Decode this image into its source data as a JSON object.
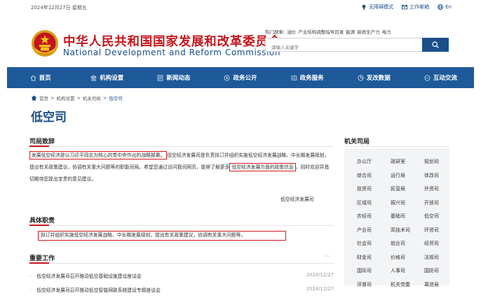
{
  "topbar": {
    "date": "2024年12月27日 星期五",
    "links": [
      {
        "icon": "accessibility-icon",
        "label": "无障碍模式"
      },
      {
        "icon": "mail-icon",
        "label": "工作邮箱"
      },
      {
        "icon": "globe-icon",
        "label": "En"
      }
    ]
  },
  "header": {
    "title_cn": "中华人民共和国国家发展和改革委员会",
    "title_en": "National Development and Reform Commission",
    "hot_label": "热门搜索:",
    "hot_keywords": [
      "油价",
      "产业结构调整指导目录",
      "能源",
      "新质生产力",
      "电力"
    ],
    "search_placeholder": "请输入关键字"
  },
  "nav": {
    "items": [
      {
        "label": "首页",
        "icon": "home-icon"
      },
      {
        "label": "机构设置",
        "icon": "building-icon"
      },
      {
        "label": "新闻动态",
        "icon": "news-icon"
      },
      {
        "label": "政务公开",
        "icon": "open-icon"
      },
      {
        "label": "政务服务",
        "icon": "service-icon"
      },
      {
        "label": "发改数据",
        "icon": "data-icon"
      },
      {
        "label": "互动交流",
        "icon": "chat-icon"
      }
    ]
  },
  "breadcrumb": {
    "items": [
      "首页",
      "机构设置",
      "机关司局",
      "低空司"
    ],
    "sep": ">"
  },
  "page": {
    "title": "低空司"
  },
  "intro": {
    "heading": "司局致辞",
    "hl1": "发展低空经济是以习近平同志为核心的党中央作出的战略部署。",
    "text1": "低空经济发展司是负责拟订并组织实施低空经济发展战略、中长期发展规划，提出有关政策建议，协调有关重大问题等的职能司局。希望您通过访问我司网页，能够了解更多",
    "hl2": "低空经济发展方面的政策信息",
    "text2": "，同时欢迎并恳切期待您提出宝贵的意见建议。",
    "sign": "低空经济发展司"
  },
  "duties": {
    "heading": "具体职责",
    "text": "拟订并组织实施低空经济发展战略、中长期发展规划，提出有关政策建议，协调有关重大问题等。"
  },
  "work": {
    "heading": "重要工作",
    "more": "···",
    "items": [
      {
        "title": "低空经济发展司召开推动低空基础设施建设座谈会",
        "date": "2024/12/27"
      },
      {
        "title": "低空经济发展司召开推动低空智能网联系统建设专题座谈会",
        "date": "2024/12/27"
      }
    ]
  },
  "sidebar": {
    "heading": "机关司局",
    "items": [
      "办公厅",
      "政研室",
      "规划司",
      "综合司",
      "运行局",
      "体改司",
      "投资司",
      "民营局",
      "外资司",
      "区域司",
      "振兴司",
      "开放司",
      "农经司",
      "基础司",
      "低空司",
      "产业司",
      "高技术司",
      "环资司",
      "社会司",
      "就业司",
      "经贸司",
      "财金司",
      "价格司",
      "法规司",
      "国际司",
      "人事司",
      "国防司",
      "评督司",
      "机关党委",
      "离退局"
    ]
  },
  "colors": {
    "brand_red": "#c4161c",
    "brand_blue": "#1a4f8a",
    "nav_bg": "#1e5a9a",
    "highlight_border": "#d6181e"
  }
}
